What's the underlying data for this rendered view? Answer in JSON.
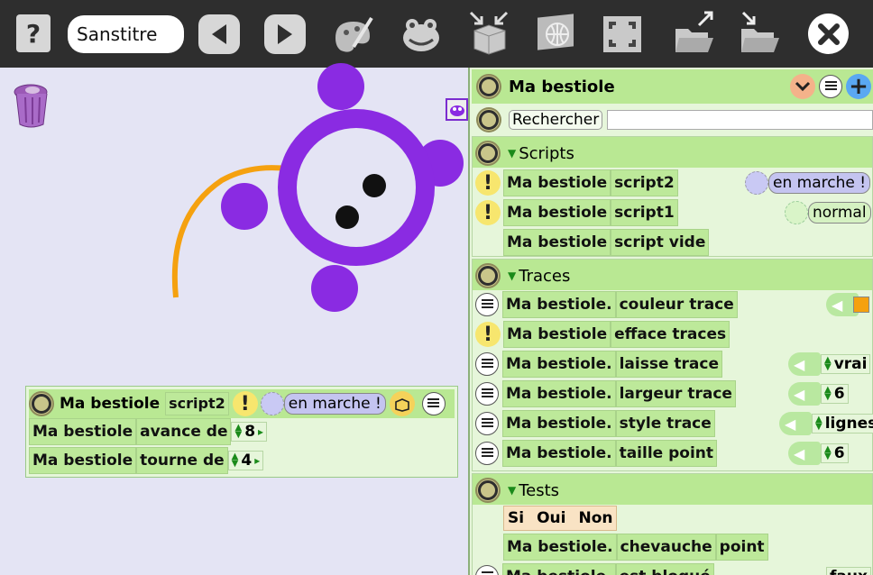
{
  "toolbar": {
    "help_label": "?",
    "title_value": "Sanstitre",
    "icons": [
      "help-icon",
      "back-icon",
      "forward-icon",
      "paint-icon",
      "frog-icon",
      "object-box-icon",
      "globe-icon",
      "fullscreen-icon",
      "open-folder-icon",
      "save-folder-icon",
      "close-icon"
    ]
  },
  "colors": {
    "toolbar_bg": "#2e2e2e",
    "world_bg": "#e4e4f4",
    "sprite_purple": "#8a2be2",
    "trace_orange": "#f5a10f",
    "block_green": "#bde99a",
    "header_green": "#b9e893"
  },
  "script_editor": {
    "header": {
      "object": "Ma bestiole",
      "script": "script2",
      "status": "en marche !"
    },
    "rows": [
      {
        "object": "Ma bestiole",
        "action": "avance de",
        "value": "8"
      },
      {
        "object": "Ma bestiole",
        "action": "tourne de",
        "value": "4"
      }
    ]
  },
  "inspector": {
    "title": "Ma bestiole",
    "search_label": "Rechercher",
    "search_value": "",
    "scripts": {
      "title": "Scripts",
      "items": [
        {
          "object": "Ma bestiole",
          "name": "script2",
          "status": "en marche !"
        },
        {
          "object": "Ma bestiole",
          "name": "script1",
          "status": "normal"
        },
        {
          "object": "Ma bestiole",
          "name": "script vide"
        }
      ]
    },
    "traces": {
      "title": "Traces",
      "items": [
        {
          "object": "Ma bestiole.",
          "name": "couleur trace",
          "value": ""
        },
        {
          "object": "Ma bestiole",
          "name": "efface traces"
        },
        {
          "object": "Ma bestiole.",
          "name": "laisse trace",
          "value": "vrai"
        },
        {
          "object": "Ma bestiole.",
          "name": "largeur trace",
          "value": "6"
        },
        {
          "object": "Ma bestiole.",
          "name": "style trace",
          "value": "lignes"
        },
        {
          "object": "Ma bestiole.",
          "name": "taille point",
          "value": "6"
        }
      ]
    },
    "tests": {
      "title": "Tests",
      "if_block": {
        "si": "Si",
        "oui": "Oui",
        "non": "Non"
      },
      "items": [
        {
          "object": "Ma bestiole.",
          "name": "chevauche",
          "arg": "point"
        },
        {
          "object": "Ma bestiole.",
          "name": "est bloqué",
          "value": "faux"
        }
      ]
    }
  }
}
